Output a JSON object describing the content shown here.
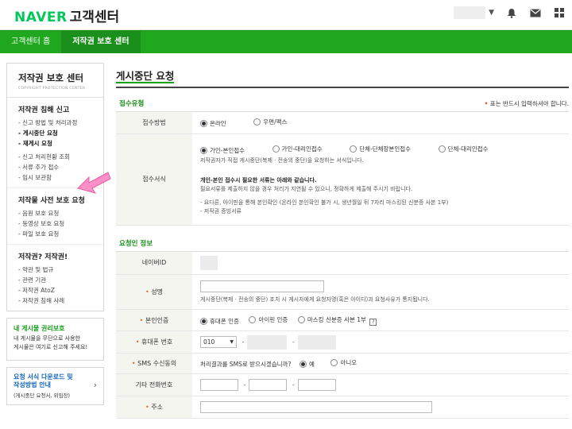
{
  "header": {
    "brand": "NAVER",
    "service": "고객센터",
    "icons": [
      "bell-icon",
      "mail-icon",
      "grid-icon"
    ]
  },
  "gnb": {
    "items": [
      "고객센터 홈",
      "저작권 보호 센터"
    ]
  },
  "lnb": {
    "title": "저작권 보호 센터",
    "subtitle": "COPYRIGHT PROTECTION CENTER",
    "groups": [
      {
        "title": "저작권 침해 신고",
        "items": [
          "신고 방법 및 처리과정",
          "게시중단 요청",
          "재게시 요청",
          "신고 처리현황 조회",
          "서류 추가 접수",
          "임시 보관함"
        ]
      },
      {
        "title": "저작물 사전 보호 요청",
        "items": [
          "음원 보호 요청",
          "동영상 보호 요청",
          "파일 보호 요청"
        ]
      },
      {
        "title": "저작권? 저작권!",
        "items": [
          "약관 및 법규",
          "관련 기관",
          "저작권 AtoZ",
          "저작권 침해 사례"
        ]
      }
    ],
    "promo1": {
      "title": "내 게시물 권리보호",
      "desc1": "내 게시물을 무단으로 사용한",
      "desc2": "게시물은 여기로 신고해 주세요!"
    },
    "promo2": {
      "title1": "요청 서식 다운로드 및",
      "title2": "작성방법 안내",
      "desc": "(게시중단 요청서, 위임장)"
    }
  },
  "content": {
    "title": "게시중단 요청",
    "section1": "접수유형",
    "required_note_mark": "•",
    "required_note": " 표는 반드시 입력하셔야 합니다.",
    "receipt_method": {
      "label": "접수방법",
      "options": [
        "온라인",
        "우편/팩스"
      ],
      "selected": 0
    },
    "receipt_form": {
      "label": "접수서식",
      "options": [
        "가인-본인접수",
        "가인-대리인접수",
        "단체-단체장본인접수",
        "단체-대리인접수"
      ],
      "selected": 0,
      "desc": "저작권자가 직접 게시중단(복제 · 전송의 중단)을 요청하는 서식입니다.",
      "info_title": "개인-본인 접수시 필요한 서류는 아래와 같습니다.",
      "info1": "필요서류를 제출하지 않을 경우 처리가 지연될 수 있으니, 정확하게 제출해 주시기 바랍니다.",
      "info2": "- 요다른, 아이핀을 통해 본인확인 (온라인 본인확인 불가 시, 생년월일 뒤 7자리 마스킹된 신분증 사본 1부)",
      "info3": "- 저작권 증빙서류"
    },
    "section2": "요청인 정보",
    "naver_id": {
      "label": "네이버ID"
    },
    "name": {
      "label": "성명",
      "desc": "게시중단(복제 · 전송의 중단) 조치 시 게시자에게 요청자명(혹은 아이디)과 요청사유가 통지됩니다."
    },
    "auth": {
      "label": "본인인증",
      "options": [
        "휴대폰 인증",
        "아이핀 인증",
        "마스킹 신분증 사본 1부"
      ],
      "selected": 0,
      "help": "?"
    },
    "phone": {
      "label": "휴대폰 번호",
      "prefix": "010"
    },
    "sms": {
      "label": "SMS 수신동의",
      "question": "처리결과를 SMS로 받으시겠습니까?",
      "options": [
        "예",
        "아니오"
      ],
      "selected": 0
    },
    "other_phone": {
      "label": "기타 전화번호"
    },
    "address": {
      "label": "주소"
    }
  }
}
